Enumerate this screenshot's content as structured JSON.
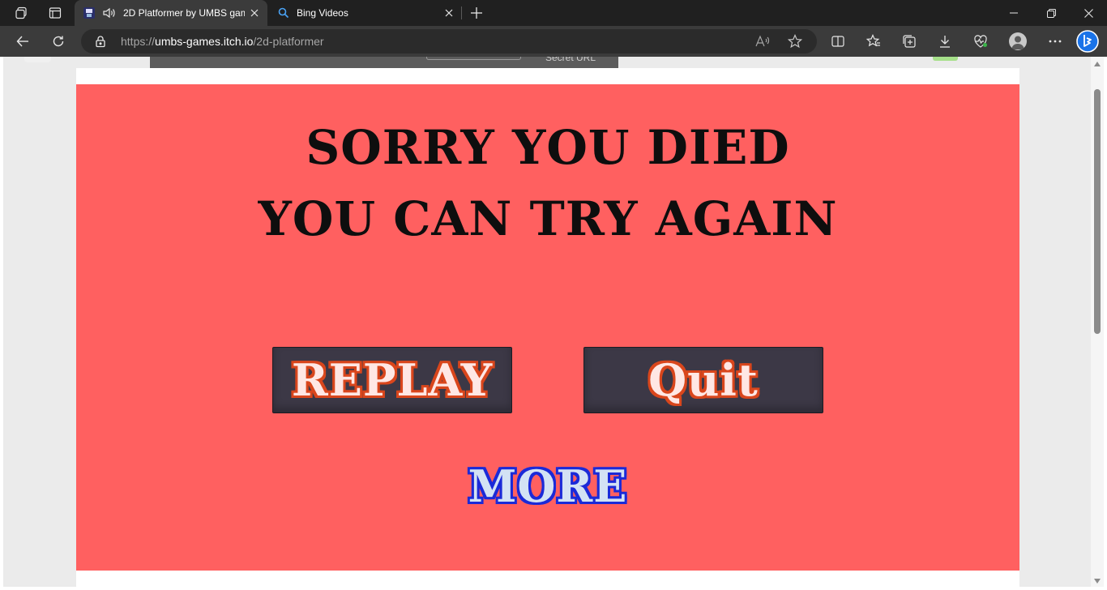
{
  "browser": {
    "tabs": [
      {
        "title": "2D Platformer by UMBS gam",
        "active": true,
        "audio": true
      },
      {
        "title": "Bing Videos",
        "active": false
      }
    ],
    "address": {
      "scheme": "https://",
      "host": "umbs-games.itch.io",
      "path": "/2d-platformer"
    },
    "icons": {
      "workspaces": "workspaces-icon",
      "tab_actions": "vertical-tabs-icon",
      "back": "back-arrow-icon",
      "refresh": "refresh-icon",
      "read_aloud": "read-aloud-icon",
      "favorite": "star-icon",
      "split_screen": "split-screen-icon",
      "favorites": "favorites-icon",
      "collections": "collections-icon",
      "downloads": "download-icon",
      "health": "browser-essentials-icon",
      "profile": "profile-avatar-icon",
      "more": "more-icon",
      "copilot": "bing-copilot-icon"
    }
  },
  "itch": {
    "secret_url_label": "Secret URL"
  },
  "game": {
    "line1": "SORRY YOU DIED",
    "line2": "YOU CAN TRY AGAIN",
    "replay_label": "REPLAY",
    "quit_label": "Quit",
    "more_label": "MORE",
    "colors": {
      "background": "#ff6060",
      "button_bg": "#3c3846",
      "button_text": "#ffe7e4",
      "button_outline": "#d9461c",
      "more_text": "#d3e2f4",
      "more_outline": "#1b2ad8"
    }
  }
}
